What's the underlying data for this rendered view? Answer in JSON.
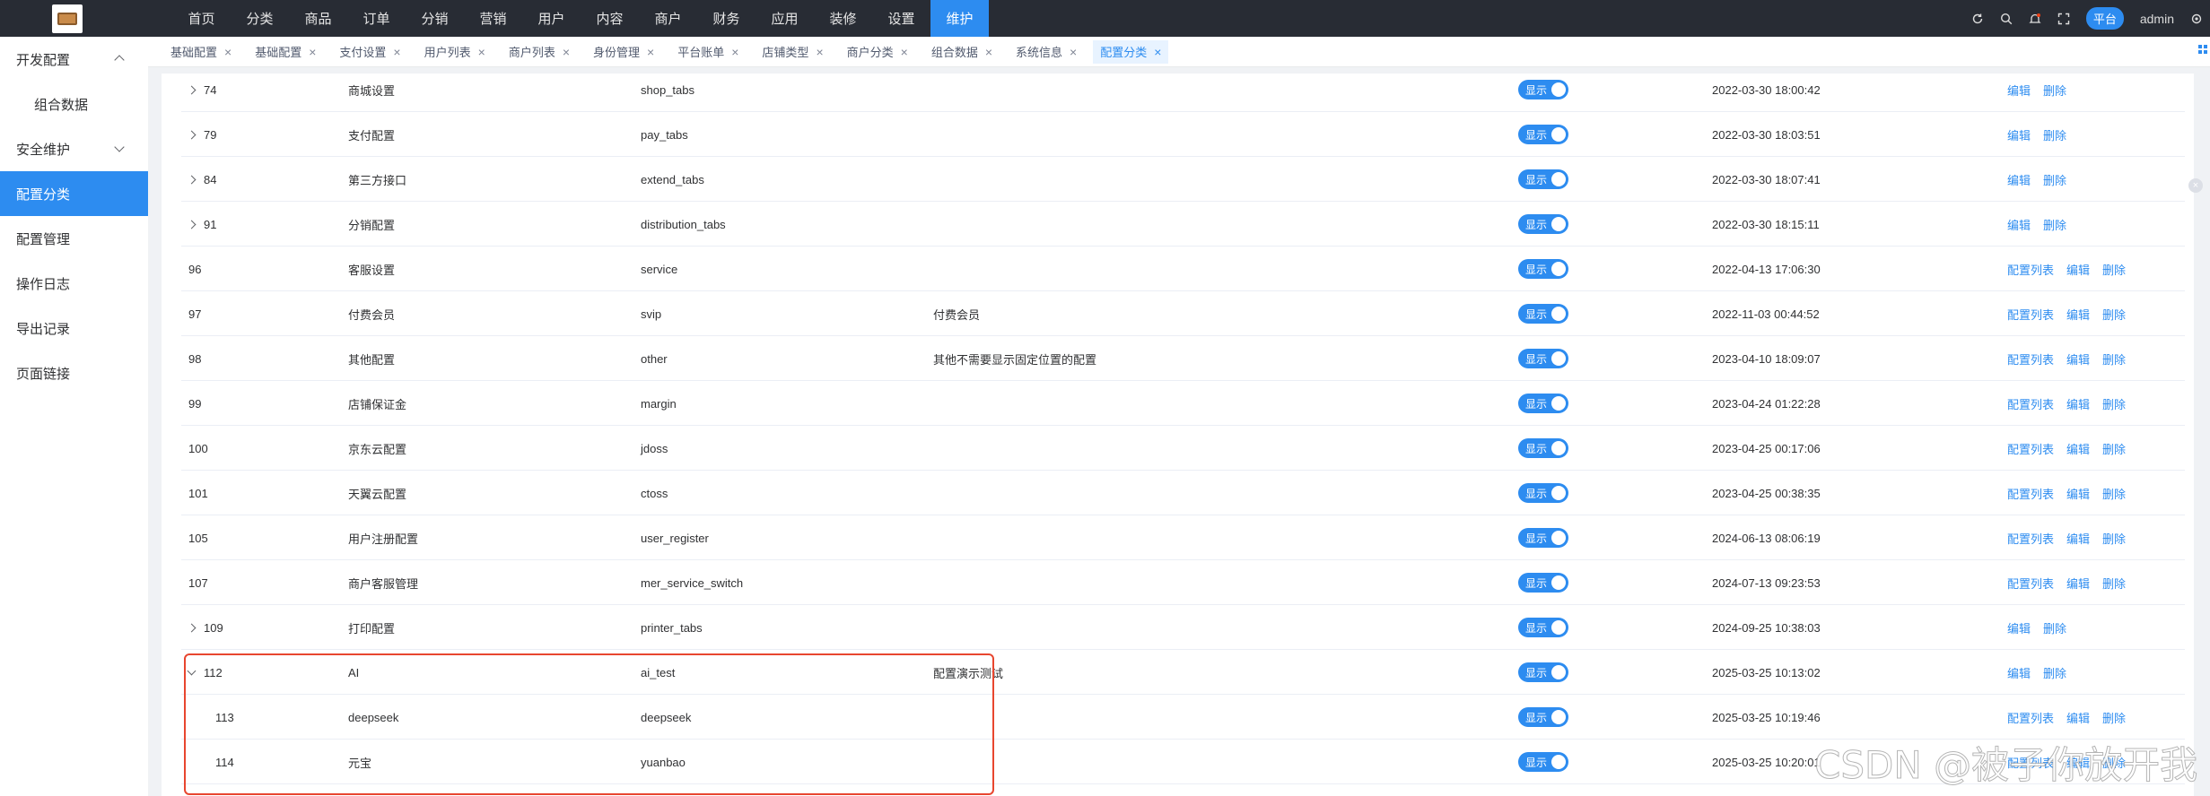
{
  "header": {
    "nav": [
      "首页",
      "分类",
      "商品",
      "订单",
      "分销",
      "营销",
      "用户",
      "内容",
      "商户",
      "财务",
      "应用",
      "装修",
      "设置",
      "维护"
    ],
    "active_index": 13,
    "platform_label": "平台",
    "user_label": "admin",
    "right_icons": [
      "refresh-icon",
      "search-icon",
      "bell-icon",
      "fullscreen-icon"
    ]
  },
  "sidebar": {
    "items": [
      {
        "label": "开发配置",
        "chevron": "up"
      },
      {
        "label": "组合数据",
        "sub": true
      },
      {
        "label": "安全维护",
        "chevron": "down"
      },
      {
        "label": "配置分类",
        "active": true
      },
      {
        "label": "配置管理"
      },
      {
        "label": "操作日志"
      },
      {
        "label": "导出记录"
      },
      {
        "label": "页面链接"
      }
    ]
  },
  "tabs": [
    {
      "label": "基础配置"
    },
    {
      "label": "基础配置"
    },
    {
      "label": "支付设置"
    },
    {
      "label": "用户列表"
    },
    {
      "label": "商户列表"
    },
    {
      "label": "身份管理"
    },
    {
      "label": "平台账单"
    },
    {
      "label": "店铺类型"
    },
    {
      "label": "商户分类"
    },
    {
      "label": "组合数据"
    },
    {
      "label": "系统信息"
    },
    {
      "label": "配置分类",
      "active": true
    }
  ],
  "table": {
    "rows": [
      {
        "id": "74",
        "name": "商城设置",
        "key": "shop_tabs",
        "desc": "",
        "status": "显示",
        "date": "2022-03-30 18:00:42",
        "expand": "closed",
        "ops": [
          "编辑",
          "删除"
        ]
      },
      {
        "id": "79",
        "name": "支付配置",
        "key": "pay_tabs",
        "desc": "",
        "status": "显示",
        "date": "2022-03-30 18:03:51",
        "expand": "closed",
        "ops": [
          "编辑",
          "删除"
        ]
      },
      {
        "id": "84",
        "name": "第三方接口",
        "key": "extend_tabs",
        "desc": "",
        "status": "显示",
        "date": "2022-03-30 18:07:41",
        "expand": "closed",
        "ops": [
          "编辑",
          "删除"
        ]
      },
      {
        "id": "91",
        "name": "分销配置",
        "key": "distribution_tabs",
        "desc": "",
        "status": "显示",
        "date": "2022-03-30 18:15:11",
        "expand": "closed",
        "ops": [
          "编辑",
          "删除"
        ]
      },
      {
        "id": "96",
        "name": "客服设置",
        "key": "service",
        "desc": "",
        "status": "显示",
        "date": "2022-04-13 17:06:30",
        "expand": "",
        "ops": [
          "配置列表",
          "编辑",
          "删除"
        ]
      },
      {
        "id": "97",
        "name": "付费会员",
        "key": "svip",
        "desc": "付费会员",
        "status": "显示",
        "date": "2022-11-03 00:44:52",
        "expand": "",
        "ops": [
          "配置列表",
          "编辑",
          "删除"
        ]
      },
      {
        "id": "98",
        "name": "其他配置",
        "key": "other",
        "desc": "其他不需要显示固定位置的配置",
        "status": "显示",
        "date": "2023-04-10 18:09:07",
        "expand": "",
        "ops": [
          "配置列表",
          "编辑",
          "删除"
        ]
      },
      {
        "id": "99",
        "name": "店铺保证金",
        "key": "margin",
        "desc": "",
        "status": "显示",
        "date": "2023-04-24 01:22:28",
        "expand": "",
        "ops": [
          "配置列表",
          "编辑",
          "删除"
        ]
      },
      {
        "id": "100",
        "name": "京东云配置",
        "key": "jdoss",
        "desc": "",
        "status": "显示",
        "date": "2023-04-25 00:17:06",
        "expand": "",
        "ops": [
          "配置列表",
          "编辑",
          "删除"
        ]
      },
      {
        "id": "101",
        "name": "天翼云配置",
        "key": "ctoss",
        "desc": "",
        "status": "显示",
        "date": "2023-04-25 00:38:35",
        "expand": "",
        "ops": [
          "配置列表",
          "编辑",
          "删除"
        ]
      },
      {
        "id": "105",
        "name": "用户注册配置",
        "key": "user_register",
        "desc": "",
        "status": "显示",
        "date": "2024-06-13 08:06:19",
        "expand": "",
        "ops": [
          "配置列表",
          "编辑",
          "删除"
        ]
      },
      {
        "id": "107",
        "name": "商户客服管理",
        "key": "mer_service_switch",
        "desc": "",
        "status": "显示",
        "date": "2024-07-13 09:23:53",
        "expand": "",
        "ops": [
          "配置列表",
          "编辑",
          "删除"
        ]
      },
      {
        "id": "109",
        "name": "打印配置",
        "key": "printer_tabs",
        "desc": "",
        "status": "显示",
        "date": "2024-09-25 10:38:03",
        "expand": "closed",
        "ops": [
          "编辑",
          "删除"
        ]
      },
      {
        "id": "112",
        "name": "AI",
        "key": "ai_test",
        "desc": "配置演示测试",
        "status": "显示",
        "date": "2025-03-25 10:13:02",
        "expand": "open",
        "ops": [
          "编辑",
          "删除"
        ]
      },
      {
        "id": "113",
        "name": "deepseek",
        "key": "deepseek",
        "desc": "",
        "status": "显示",
        "date": "2025-03-25 10:19:46",
        "expand": "child",
        "ops": [
          "配置列表",
          "编辑",
          "删除"
        ]
      },
      {
        "id": "114",
        "name": "元宝",
        "key": "yuanbao",
        "desc": "",
        "status": "显示",
        "date": "2025-03-25 10:20:01",
        "expand": "child",
        "ops": [
          "配置列表",
          "编辑",
          "删除"
        ]
      }
    ]
  },
  "watermark": "CSDN @被子你放开我",
  "colors": {
    "accent": "#2d8cf0",
    "topbar": "#282c34",
    "highlight": "#e8462f"
  }
}
